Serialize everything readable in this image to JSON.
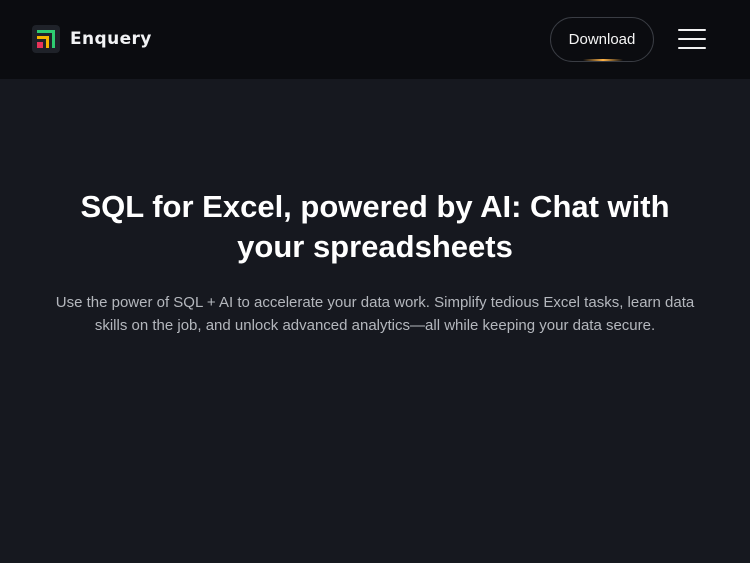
{
  "brand": {
    "name": "Enquery",
    "logo_icon": "enquery-logo-icon",
    "logo_colors": [
      "#2ecc71",
      "#f5b400",
      "#e8345a"
    ]
  },
  "nav": {
    "download_label": "Download",
    "menu_icon": "hamburger-menu-icon"
  },
  "hero": {
    "title": "SQL for Excel, powered by AI: Chat with your spreadsheets",
    "subtitle": "Use the power of SQL + AI to accelerate your data work. Simplify tedious Excel tasks, learn data skills on the job, and unlock advanced analytics—all while keeping your data secure."
  },
  "colors": {
    "header_bg": "#0b0c10",
    "page_bg": "#16181f",
    "accent_glow": "#ffb347"
  }
}
